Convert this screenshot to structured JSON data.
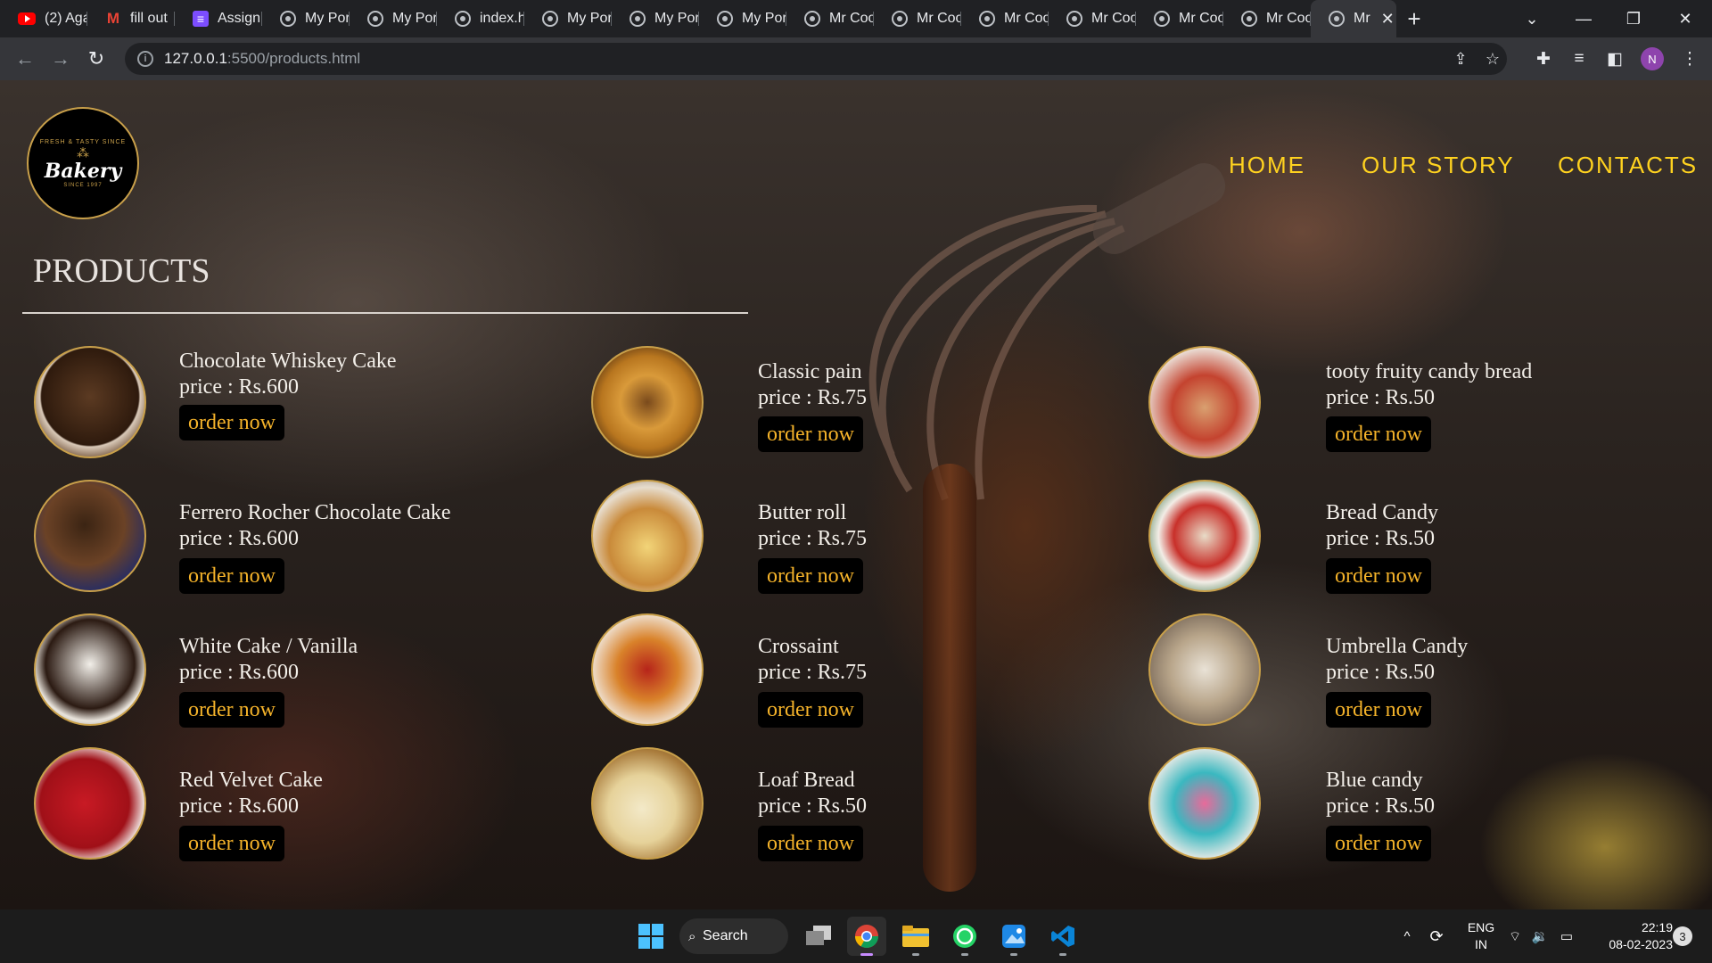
{
  "browser": {
    "tabs": [
      {
        "title": "(2) Aga",
        "icon": "youtube-icon"
      },
      {
        "title": "fill out",
        "icon": "gmail-icon"
      },
      {
        "title": "Assignm",
        "icon": "classroom-icon"
      },
      {
        "title": "My Por",
        "icon": "globe-icon"
      },
      {
        "title": "My Por",
        "icon": "globe-icon"
      },
      {
        "title": "index.h",
        "icon": "globe-icon"
      },
      {
        "title": "My Por",
        "icon": "globe-icon"
      },
      {
        "title": "My Por",
        "icon": "globe-icon"
      },
      {
        "title": "My Por",
        "icon": "globe-icon"
      },
      {
        "title": "Mr Coo",
        "icon": "globe-icon"
      },
      {
        "title": "Mr Coo",
        "icon": "globe-icon"
      },
      {
        "title": "Mr Coo",
        "icon": "globe-icon"
      },
      {
        "title": "Mr Coo",
        "icon": "globe-icon"
      },
      {
        "title": "Mr Coo",
        "icon": "globe-icon"
      },
      {
        "title": "Mr Coo",
        "icon": "globe-icon"
      }
    ],
    "active_tab": {
      "title": "Mr",
      "icon": "globe-icon"
    },
    "url_host": "127.0.0.1",
    "url_rest": ":5500/products.html",
    "profile_initial": "N"
  },
  "site": {
    "logo": {
      "top": "FRESH & TASTY SINCE",
      "name": "Bakery",
      "since": "SINCE 1997"
    },
    "nav": [
      "HOME",
      "OUR STORY",
      "CONTACTS"
    ],
    "page_title": "PRODUCTS",
    "order_label": "order now",
    "products": [
      {
        "name": "Chocolate Whiskey Cake",
        "price": "price : Rs.600"
      },
      {
        "name": "Classic pain",
        "price": "price : Rs.75"
      },
      {
        "name": "tooty fruity candy bread",
        "price": "price : Rs.50"
      },
      {
        "name": "Ferrero Rocher Chocolate Cake",
        "price": "price : Rs.600"
      },
      {
        "name": "Butter roll",
        "price": "price : Rs.75"
      },
      {
        "name": "Bread Candy",
        "price": "price : Rs.50"
      },
      {
        "name": "White Cake / Vanilla",
        "price": "price : Rs.600"
      },
      {
        "name": "Crossaint",
        "price": "price : Rs.75"
      },
      {
        "name": "Umbrella Candy",
        "price": "price : Rs.50"
      },
      {
        "name": "Red Velvet Cake",
        "price": "price : Rs.600"
      },
      {
        "name": "Loaf Bread",
        "price": "price : Rs.50"
      },
      {
        "name": "Blue candy",
        "price": "price : Rs.50"
      }
    ]
  },
  "taskbar": {
    "search_label": "Search",
    "language": "ENG",
    "region": "IN",
    "time": "22:19",
    "date": "08-02-2023",
    "notification_count": "3"
  },
  "colors": {
    "nav": "#ffd21f",
    "order_text": "#f5b32a",
    "thumb_border": "#c9a04a"
  }
}
